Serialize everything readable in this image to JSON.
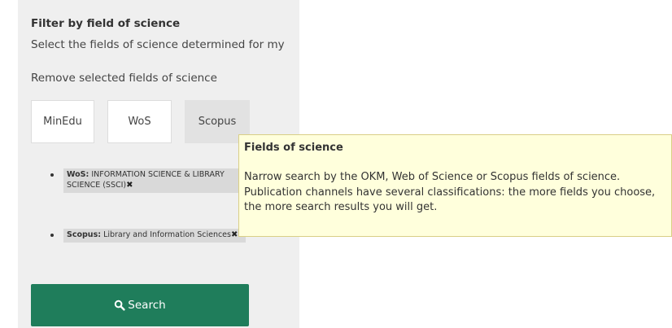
{
  "filter": {
    "title": "Filter by field of science",
    "select_link": "Select the fields of science determined for my",
    "remove_link": "Remove selected fields of science"
  },
  "field_buttons": [
    {
      "label": "MinEdu",
      "active": false
    },
    {
      "label": "WoS",
      "active": false
    },
    {
      "label": "Scopus",
      "active": true
    }
  ],
  "selected_fields": [
    {
      "prefix": "WoS:",
      "name": "INFORMATION SCIENCE & LIBRARY SCIENCE (SSCI)",
      "remove": "✖"
    },
    {
      "prefix": "Scopus:",
      "name": "Library and Information Sciences",
      "remove": "✖"
    }
  ],
  "search_button": {
    "label": "Search",
    "icon": "search-icon",
    "color": "#1f7d5b"
  },
  "tooltip": {
    "title": "Fields of science",
    "body": "Narrow search by the OKM, Web of Science or Scopus fields of science. Publication channels have several classifications: the more fields you choose, the more search results you will get.",
    "background": "#ffffdc"
  }
}
